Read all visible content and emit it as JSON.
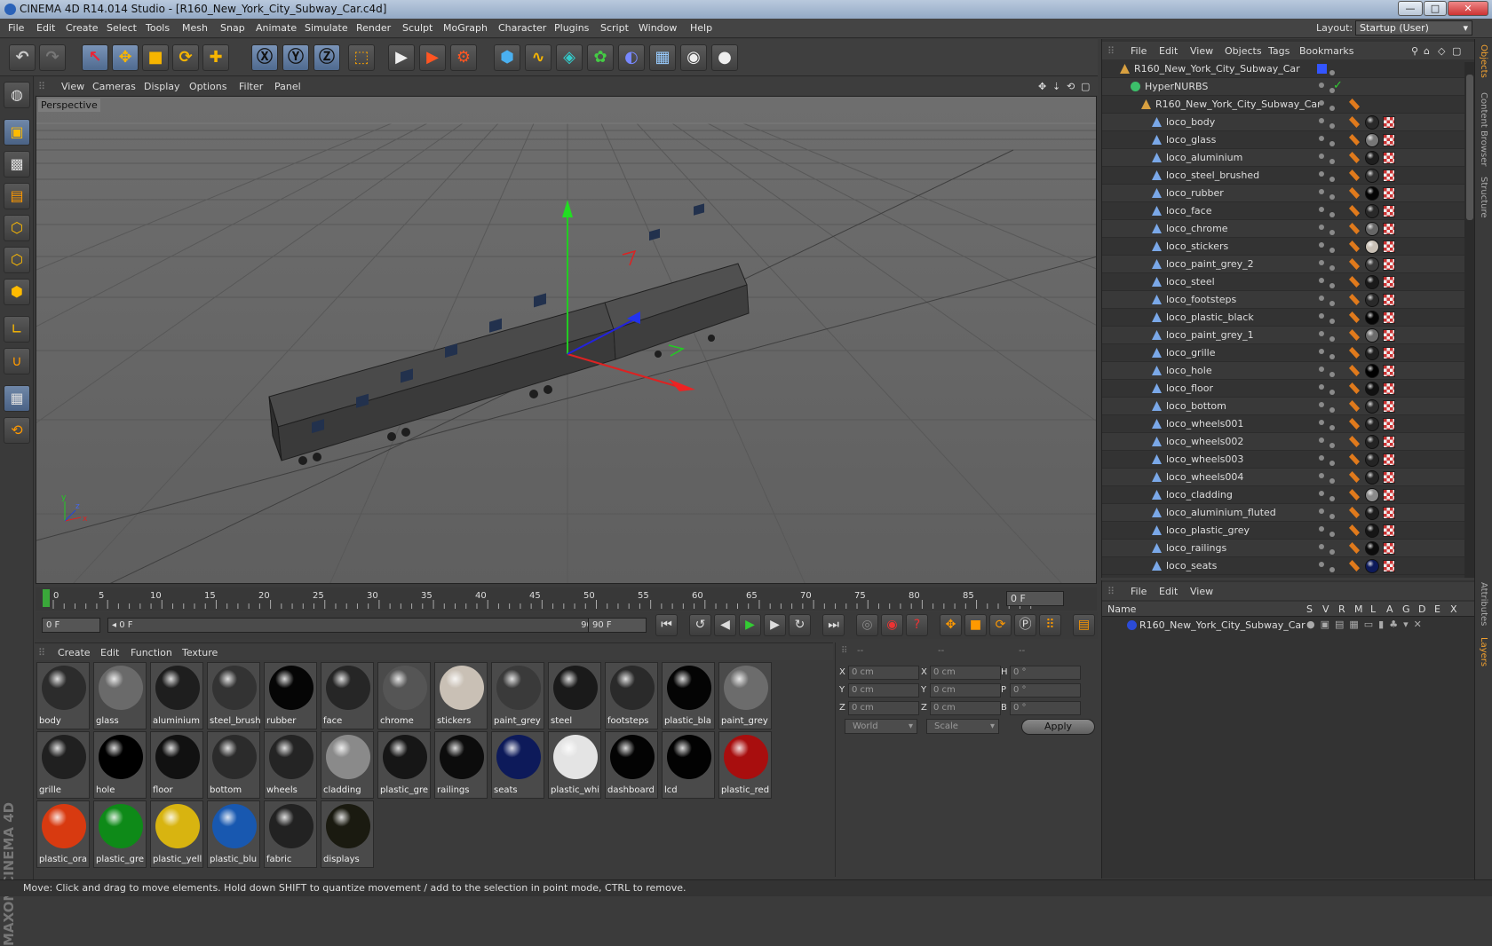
{
  "window": {
    "title": "CINEMA 4D R14.014 Studio - [R160_New_York_City_Subway_Car.c4d]",
    "minimize": "—",
    "maximize": "□",
    "close": "✕"
  },
  "menubar": [
    "File",
    "Edit",
    "Create",
    "Select",
    "Tools",
    "Mesh",
    "Snap",
    "Animate",
    "Simulate",
    "Render",
    "Sculpt",
    "MoGraph",
    "Character",
    "Plugins",
    "Script",
    "Window",
    "Help"
  ],
  "layout": {
    "label": "Layout:",
    "value": "Startup (User)"
  },
  "toolbar_icons": [
    "undo-icon",
    "redo-icon",
    "live-selection-icon",
    "move-icon",
    "scale-icon",
    "rotate-icon",
    "recent-tool-icon",
    "x-axis-icon",
    "y-axis-icon",
    "z-axis-icon",
    "coordinate-system-icon",
    "render-view-icon",
    "render-picture-viewer-icon",
    "edit-render-settings-icon",
    "cube-icon",
    "spline-pen-icon",
    "subdivision-icon",
    "cloner-icon",
    "deformer-icon",
    "floor-icon",
    "camera-icon",
    "light-icon"
  ],
  "viewport": {
    "menu": [
      "View",
      "Cameras",
      "Display",
      "Options",
      "Filter",
      "Panel"
    ],
    "label": "Perspective"
  },
  "timeline": {
    "ticks": [
      "0",
      "5",
      "10",
      "15",
      "20",
      "25",
      "30",
      "35",
      "40",
      "45",
      "50",
      "55",
      "60",
      "65",
      "70",
      "75",
      "80",
      "85",
      "90"
    ],
    "current_frame": "0 F",
    "start_field": "0 F",
    "range_start": "◂ 0 F",
    "range_end": "90 F ▸",
    "end_field": "90 F"
  },
  "materials": {
    "menu": [
      "Create",
      "Edit",
      "Function",
      "Texture"
    ],
    "items": [
      {
        "label": "body",
        "color": "#2c2c2c"
      },
      {
        "label": "glass",
        "color": "#6a6a6a"
      },
      {
        "label": "aluminium",
        "color": "#1e1e1e"
      },
      {
        "label": "steel_brush",
        "color": "#333333"
      },
      {
        "label": "rubber",
        "color": "#050505"
      },
      {
        "label": "face",
        "color": "#262626"
      },
      {
        "label": "chrome",
        "color": "#555555"
      },
      {
        "label": "stickers",
        "color": "#c9c0b5"
      },
      {
        "label": "paint_grey",
        "color": "#3a3a3a"
      },
      {
        "label": "steel",
        "color": "#1a1a1a"
      },
      {
        "label": "footsteps",
        "color": "#2a2a2a"
      },
      {
        "label": "plastic_bla",
        "color": "#040404"
      },
      {
        "label": "paint_grey",
        "color": "#6c6c6c"
      },
      {
        "label": "grille",
        "color": "#202020"
      },
      {
        "label": "hole",
        "color": "#000000"
      },
      {
        "label": "floor",
        "color": "#111111"
      },
      {
        "label": "bottom",
        "color": "#2b2b2b"
      },
      {
        "label": "wheels",
        "color": "#242424"
      },
      {
        "label": "cladding",
        "color": "#8a8a8a"
      },
      {
        "label": "plastic_gre",
        "color": "#161616"
      },
      {
        "label": "railings",
        "color": "#0c0c0c"
      },
      {
        "label": "seats",
        "color": "#0d1a5a"
      },
      {
        "label": "plastic_whi",
        "color": "#e4e4e4"
      },
      {
        "label": "dashboard",
        "color": "#030303"
      },
      {
        "label": "lcd",
        "color": "#020202"
      },
      {
        "label": "plastic_red",
        "color": "#a80e0e"
      },
      {
        "label": "plastic_ora",
        "color": "#d83a10"
      },
      {
        "label": "plastic_gre",
        "color": "#0e8a18"
      },
      {
        "label": "plastic_yell",
        "color": "#d8b410"
      },
      {
        "label": "plastic_blu",
        "color": "#1858b0"
      },
      {
        "label": "fabric",
        "color": "#222222"
      },
      {
        "label": "displays",
        "color": "#1a1a10"
      }
    ]
  },
  "coordinates": {
    "header": [
      "--",
      "--",
      "--"
    ],
    "rows": [
      {
        "a": "X",
        "av": "0 cm",
        "b": "X",
        "bv": "0 cm",
        "c": "H",
        "cv": "0 °"
      },
      {
        "a": "Y",
        "av": "0 cm",
        "b": "Y",
        "bv": "0 cm",
        "c": "P",
        "cv": "0 °"
      },
      {
        "a": "Z",
        "av": "0 cm",
        "b": "Z",
        "bv": "0 cm",
        "c": "B",
        "cv": "0 °"
      }
    ],
    "mode": "World",
    "scale": "Scale",
    "apply": "Apply"
  },
  "objects": {
    "menu": [
      "File",
      "Edit",
      "View",
      "Objects",
      "Tags",
      "Bookmarks"
    ],
    "root": "R160_New_York_City_Subway_Car",
    "nurbs": "HyperNURBS",
    "group": "R160_New_York_City_Subway_Car",
    "items": [
      {
        "name": "loco_body",
        "ball": "#2a2a2a"
      },
      {
        "name": "loco_glass",
        "ball": "#777777"
      },
      {
        "name": "loco_aluminium",
        "ball": "#1e1e1e"
      },
      {
        "name": "loco_steel_brushed",
        "ball": "#333333"
      },
      {
        "name": "loco_rubber",
        "ball": "#050505"
      },
      {
        "name": "loco_face",
        "ball": "#2a2a2a"
      },
      {
        "name": "loco_chrome",
        "ball": "#666666"
      },
      {
        "name": "loco_stickers",
        "ball": "#c9c0b5"
      },
      {
        "name": "loco_paint_grey_2",
        "ball": "#3a3a3a"
      },
      {
        "name": "loco_steel",
        "ball": "#1a1a1a"
      },
      {
        "name": "loco_footsteps",
        "ball": "#2a2a2a"
      },
      {
        "name": "loco_plastic_black",
        "ball": "#050505"
      },
      {
        "name": "loco_paint_grey_1",
        "ball": "#6c6c6c"
      },
      {
        "name": "loco_grille",
        "ball": "#202020"
      },
      {
        "name": "loco_hole",
        "ball": "#000000"
      },
      {
        "name": "loco_floor",
        "ball": "#111111"
      },
      {
        "name": "loco_bottom",
        "ball": "#2b2b2b"
      },
      {
        "name": "loco_wheels001",
        "ball": "#242424"
      },
      {
        "name": "loco_wheels002",
        "ball": "#242424"
      },
      {
        "name": "loco_wheels003",
        "ball": "#242424"
      },
      {
        "name": "loco_wheels004",
        "ball": "#242424"
      },
      {
        "name": "loco_cladding",
        "ball": "#8a8a8a"
      },
      {
        "name": "loco_aluminium_fluted",
        "ball": "#1e1e1e"
      },
      {
        "name": "loco_plastic_grey",
        "ball": "#161616"
      },
      {
        "name": "loco_railings",
        "ball": "#0c0c0c"
      },
      {
        "name": "loco_seats",
        "ball": "#0d1a5a"
      }
    ]
  },
  "layers": {
    "menu": [
      "File",
      "Edit",
      "View"
    ],
    "columns": [
      "Name",
      "S",
      "V",
      "R",
      "M",
      "L",
      "A",
      "G",
      "D",
      "E",
      "X"
    ],
    "row_name": "R160_New_York_City_Subway_Car",
    "row_color": "#2b4bd8"
  },
  "side_tabs": [
    "Objects",
    "Content Browser",
    "Structure",
    "Attributes",
    "Layers"
  ],
  "brand": "MAXON CINEMA 4D",
  "status": "Move: Click and drag to move elements. Hold down SHIFT to quantize movement / add to the selection in point mode, CTRL to remove."
}
